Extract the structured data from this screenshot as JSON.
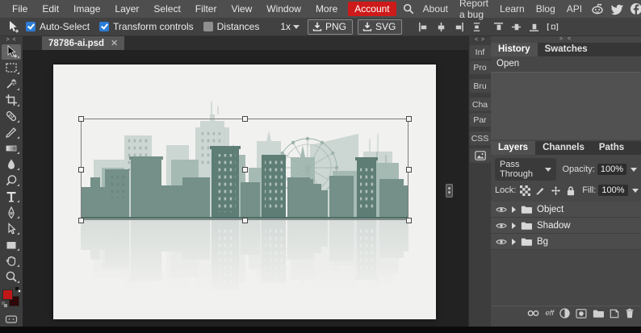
{
  "menu": {
    "items": [
      "File",
      "Edit",
      "Image",
      "Layer",
      "Select",
      "Filter",
      "View",
      "Window",
      "More"
    ],
    "account_label": "Account",
    "right_items": [
      "About",
      "Report a bug",
      "Learn",
      "Blog",
      "API"
    ],
    "social_icons": [
      "reddit-icon",
      "twitter-icon",
      "facebook-icon"
    ]
  },
  "options_bar": {
    "auto_select_label": "Auto-Select",
    "transform_controls_label": "Transform controls",
    "distances_label": "Distances",
    "zoom_level": "1x",
    "png_label": "PNG",
    "svg_label": "SVG"
  },
  "document_tab": {
    "title": "78786-ai.psd",
    "close": "✕"
  },
  "left_toolbar": {
    "tools": [
      "move",
      "marquee",
      "magic-wand",
      "crop",
      "healing",
      "brush",
      "gradient",
      "blur",
      "dodge",
      "type",
      "pen",
      "direct-select",
      "rectangle",
      "hand",
      "zoom"
    ],
    "selected_tool": "move"
  },
  "right_strip": {
    "buttons": [
      "Inf",
      "Pro",
      "Bru",
      "Cha",
      "Par",
      "CSS"
    ]
  },
  "history_panel": {
    "tabs": [
      "History",
      "Swatches"
    ],
    "active_tab": "History",
    "items": [
      "Open"
    ]
  },
  "layers_panel": {
    "tabs": [
      "Layers",
      "Channels",
      "Paths"
    ],
    "active_tab": "Layers",
    "blend_mode": "Pass Through",
    "opacity_label": "Opacity:",
    "opacity_value": "100%",
    "lock_label": "Lock:",
    "fill_label": "Fill:",
    "fill_value": "100%",
    "layers": [
      {
        "name": "Object"
      },
      {
        "name": "Shadow"
      },
      {
        "name": "Bg"
      }
    ],
    "effects_label": "eff"
  },
  "canvas": {
    "illustration": "city-skyline-with-ferris-wheel-and-reflection",
    "transform_selection_active": true
  },
  "colors": {
    "accent_red": "#cd1a1a",
    "checkbox_blue": "#2b7cd6",
    "foreground_swatch": "#c21717",
    "background_swatch": "#2d0707",
    "skyline_light": "#ccd6d2",
    "skyline_mid": "#a6bab4",
    "skyline_dark": "#749088",
    "skyline_darkest": "#5d7d75",
    "document_bg": "#f1f1ef"
  }
}
